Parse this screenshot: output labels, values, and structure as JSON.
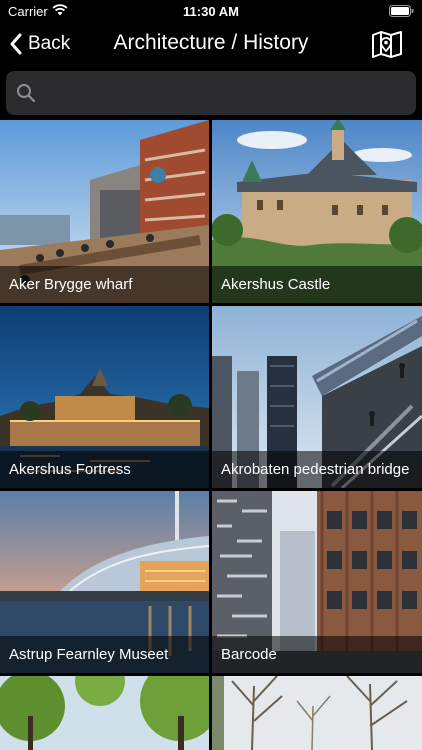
{
  "status_bar": {
    "carrier": "Carrier",
    "time": "11:30 AM",
    "wifi_icon": "wifi-icon",
    "battery_icon": "battery-icon"
  },
  "nav": {
    "back_label": "Back",
    "title": "Architecture / History",
    "map_icon": "map-icon"
  },
  "search": {
    "value": "",
    "placeholder": ""
  },
  "places": [
    {
      "name": "Aker Brygge wharf",
      "scene": "waterfront"
    },
    {
      "name": "Akershus Castle",
      "scene": "castle"
    },
    {
      "name": "Akershus Fortress",
      "scene": "fortress-night"
    },
    {
      "name": "Akrobaten pedestrian bridge",
      "scene": "bridge"
    },
    {
      "name": "Astrup Fearnley Museet",
      "scene": "museum-sunset"
    },
    {
      "name": "Barcode",
      "scene": "towers"
    },
    {
      "name": "",
      "scene": "park-trees"
    },
    {
      "name": "",
      "scene": "bare-trees"
    }
  ]
}
